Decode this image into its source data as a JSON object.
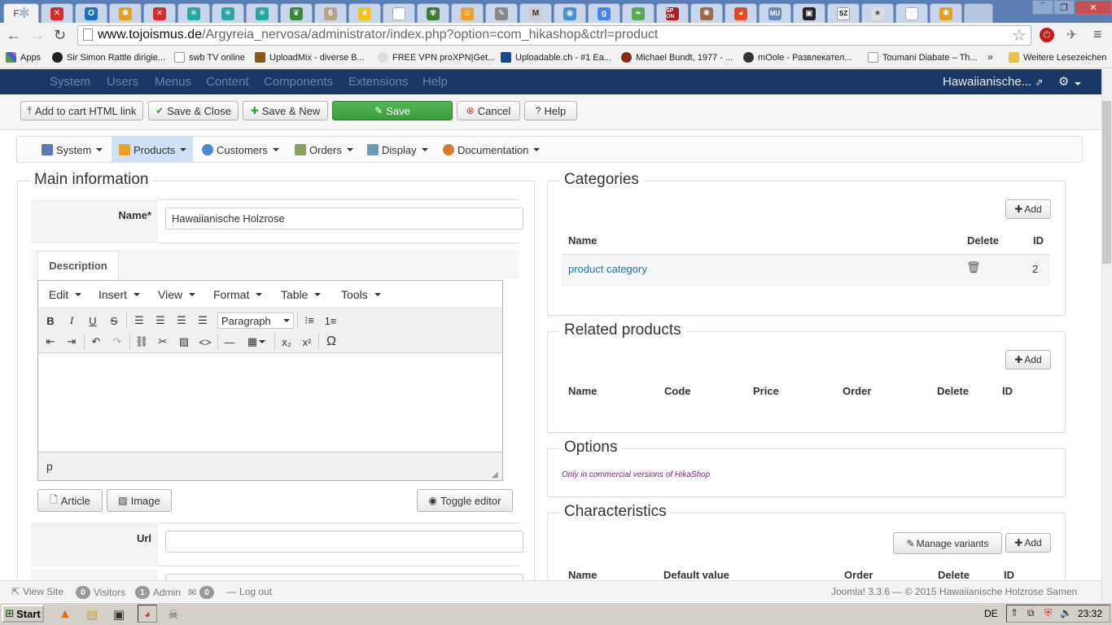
{
  "browser": {
    "active_tab": "F",
    "window_buttons": [
      "‾",
      "❐",
      "✕"
    ],
    "tab_badges": [
      "6",
      "M",
      "MU",
      "SZ",
      "SP ON"
    ],
    "url_domain": "www.tojoismus.de",
    "url_path": "/Argyreia_nervosa/administrator/index.php?option=com_hikashop&ctrl=product",
    "bookmarks": [
      "Apps",
      "Sir Simon Rattle dirigie...",
      "swb TV online",
      "UploadMix - diverse B...",
      "FREE VPN proXPN|Get...",
      "Uploadable.ch - #1 Ea...",
      "Michael Bundt, 1977 - ...",
      "mOole - Развлекател...",
      "Toumani Diabate – Th...",
      "»",
      "Weitere Lesezeichen"
    ]
  },
  "joomla": {
    "menu": [
      "System",
      "Users",
      "Menus",
      "Content",
      "Components",
      "Extensions",
      "Help"
    ],
    "site_name": "Hawaiianische...",
    "toolbar": {
      "add_to_cart": "Add to cart HTML link",
      "save_close": "Save & Close",
      "save_new": "Save & New",
      "save": "Save",
      "cancel": "Cancel",
      "help": "Help"
    }
  },
  "hikamenu": [
    "System",
    "Products",
    "Customers",
    "Orders",
    "Display",
    "Documentation"
  ],
  "main": {
    "legend": "Main information",
    "name_label": "Name*",
    "name_value": "Hawaiianische Holzrose",
    "description_tab": "Description",
    "editor": {
      "menus": [
        "Edit",
        "Insert",
        "View",
        "Format",
        "Table",
        "Tools"
      ],
      "format_select": "Paragraph",
      "path": "p"
    },
    "article_button": "Article",
    "image_button": "Image",
    "toggle_editor": "Toggle editor",
    "url_label": "Url"
  },
  "categories": {
    "legend": "Categories",
    "add": "Add",
    "columns": [
      "Name",
      "Delete",
      "ID"
    ],
    "rows": [
      {
        "name": "product category",
        "id": "2"
      }
    ]
  },
  "related": {
    "legend": "Related products",
    "add": "Add",
    "columns": [
      "Name",
      "Code",
      "Price",
      "Order",
      "Delete",
      "ID"
    ]
  },
  "options": {
    "legend": "Options",
    "note": "Only in commercial versions of HikaShop"
  },
  "characteristics": {
    "legend": "Characteristics",
    "manage": "Manage variants",
    "add": "Add",
    "columns": [
      "Name",
      "Default value",
      "Order",
      "Delete",
      "ID"
    ]
  },
  "status": {
    "view_site": "View Site",
    "visitors_count": "0",
    "visitors": "Visitors",
    "admin_count": "1",
    "admin": "Admin",
    "messages_count": "0",
    "logout": "Log out",
    "footer": "Joomla! 3.3.6 — © 2015 Hawaiianische Holzrose Samen"
  },
  "taskbar": {
    "start": "Start",
    "lang": "DE",
    "time": "23:32"
  }
}
